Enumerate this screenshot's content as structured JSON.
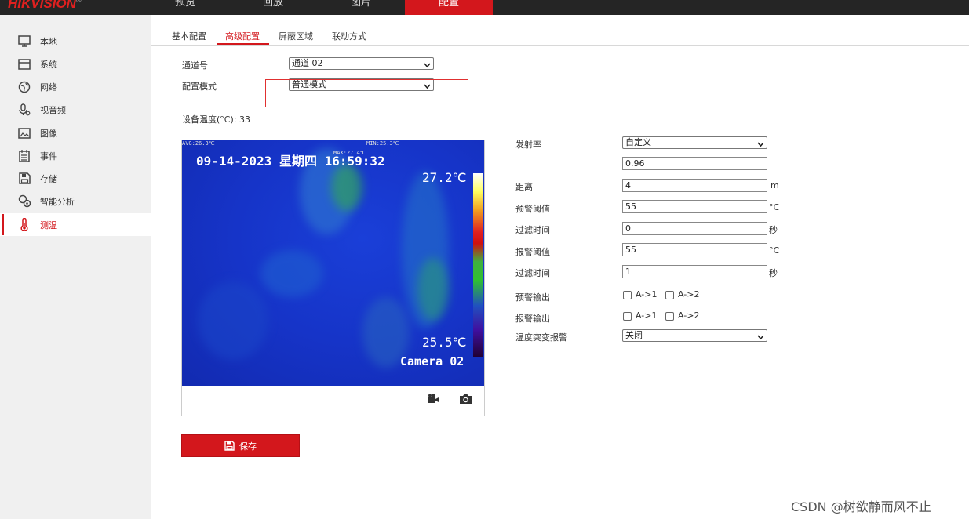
{
  "header": {
    "logo": "HIKVISION",
    "logo_mark": "®",
    "nav": [
      "预览",
      "回放",
      "图片",
      "配置"
    ],
    "active_nav": "配置",
    "accent_color": "#d3171c"
  },
  "sidebar": {
    "items": [
      {
        "label": "本地",
        "icon": "monitor-icon"
      },
      {
        "label": "系统",
        "icon": "system-icon"
      },
      {
        "label": "网络",
        "icon": "globe-icon"
      },
      {
        "label": "视音频",
        "icon": "mic-icon"
      },
      {
        "label": "图像",
        "icon": "image-icon"
      },
      {
        "label": "事件",
        "icon": "calendar-icon"
      },
      {
        "label": "存储",
        "icon": "storage-icon"
      },
      {
        "label": "智能分析",
        "icon": "analysis-icon"
      },
      {
        "label": "测温",
        "icon": "thermometer-icon"
      }
    ],
    "active": "测温"
  },
  "tabs": {
    "items": [
      "基本配置",
      "高级配置",
      "屏蔽区域",
      "联动方式"
    ],
    "active": "高级配置"
  },
  "form": {
    "channel_label": "通道号",
    "channel_value": "通道 02",
    "mode_label": "配置模式",
    "mode_value": "普通模式",
    "device_temp": "设备温度(°C): 33"
  },
  "video": {
    "osd_avg": "AVG:26.3℃",
    "osd_max": "MAX:27.4℃",
    "osd_min": "MIN:25.3℃",
    "osd_datetime": "09-14-2023 星期四 16:59:32",
    "osd_high": "27.2℃",
    "osd_low": "25.5℃",
    "osd_camera": "Camera 02"
  },
  "params": {
    "emissivity_label": "发射率",
    "emissivity_mode": "自定义",
    "emissivity_value": "0.96",
    "distance_label": "距离",
    "distance_value": "4",
    "distance_unit": "m",
    "prealarm_threshold_label": "预警阈值",
    "prealarm_threshold_value": "55",
    "prealarm_threshold_unit": "°C",
    "prealarm_filter_label": "过滤时间",
    "prealarm_filter_value": "0",
    "prealarm_filter_unit": "秒",
    "alarm_threshold_label": "报警阈值",
    "alarm_threshold_value": "55",
    "alarm_threshold_unit": "°C",
    "alarm_filter_label": "过滤时间",
    "alarm_filter_value": "1",
    "alarm_filter_unit": "秒",
    "prealarm_output_label": "预警输出",
    "alarm_output_label": "报警输出",
    "output_a1": "A->1",
    "output_a2": "A->2",
    "sudden_change_label": "温度突变报警",
    "sudden_change_value": "关闭"
  },
  "save_label": "保存",
  "watermark": "CSDN @树欲静而风不止"
}
